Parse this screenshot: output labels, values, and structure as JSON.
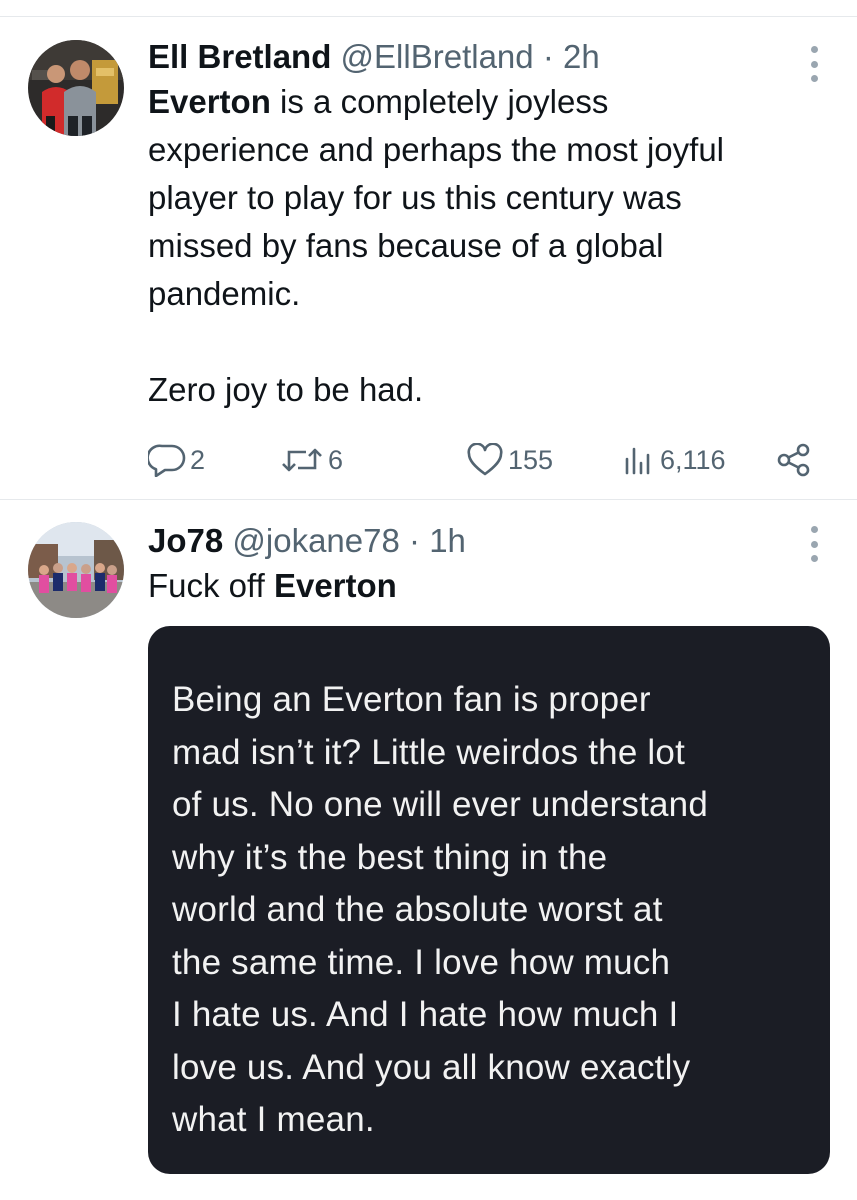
{
  "tweets": [
    {
      "display_name": "Ell Bretland",
      "handle": "@EllBretland",
      "separator": "·",
      "time": "2h",
      "text_bold": "Everton",
      "text_rest": " is a completely joyless\nexperience and perhaps the most joyful\nplayer to play for us this century was\nmissed by fans because of a global\npandemic.\n\nZero joy to be had.",
      "reply_count": "2",
      "retweet_count": "6",
      "like_count": "155",
      "view_count": "6,116"
    },
    {
      "display_name": "Jo78",
      "handle": "@jokane78",
      "separator": "·",
      "time": "1h",
      "text_plain": "Fuck off ",
      "text_bold": "Everton",
      "image_text": "Being an Everton fan is proper\nmad isn’t it? Little weirdos the lot\nof us. No one will ever understand\nwhy it’s the best thing in the\nworld and the absolute worst at\nthe same time. I love how much\nI hate us. And I hate how much I\nlove us. And you all know exactly\nwhat I mean."
    }
  ],
  "icons": {
    "reply": "reply-icon",
    "retweet": "retweet-icon",
    "like": "heart-icon",
    "views": "views-icon",
    "share": "share-icon",
    "more": "more-icon"
  },
  "colors": {
    "text": "#0f1419",
    "secondary": "#536471",
    "divider": "#e6e9ec",
    "image_bg": "#1b1d25"
  }
}
